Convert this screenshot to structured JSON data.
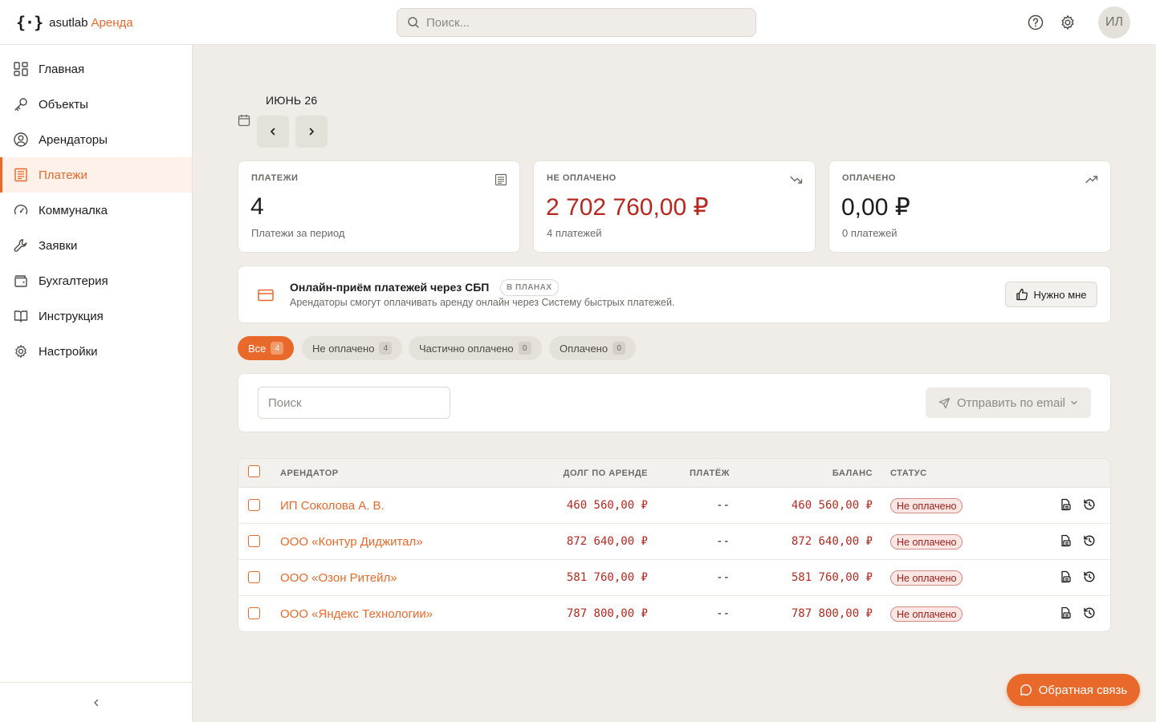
{
  "brand": {
    "mark": "{·}",
    "name": "asutlab",
    "product": "Аренда"
  },
  "header": {
    "search_placeholder": "Поиск...",
    "help_icon": "question-circle-icon",
    "settings_icon": "gear-icon",
    "avatar_initials": "ИЛ"
  },
  "sidebar": {
    "items": [
      {
        "label": "Главная",
        "icon": "dashboard-icon",
        "active": false
      },
      {
        "label": "Объекты",
        "icon": "key-icon",
        "active": false
      },
      {
        "label": "Арендаторы",
        "icon": "user-circle-icon",
        "active": false
      },
      {
        "label": "Платежи",
        "icon": "receipt-icon",
        "active": true
      },
      {
        "label": "Коммуналка",
        "icon": "gauge-icon",
        "active": false
      },
      {
        "label": "Заявки",
        "icon": "wrench-icon",
        "active": false
      },
      {
        "label": "Бухгалтерия",
        "icon": "wallet-icon",
        "active": false
      },
      {
        "label": "Инструкция",
        "icon": "book-icon",
        "active": false
      },
      {
        "label": "Настройки",
        "icon": "gear-icon",
        "active": false
      }
    ],
    "collapse_icon": "chevron-left-icon"
  },
  "period": {
    "label": "ИЮНЬ 26"
  },
  "stats": [
    {
      "label": "ПЛАТЕЖИ",
      "value": "4",
      "sub": "Платежи за период",
      "icon": "receipt-icon"
    },
    {
      "label": "НЕ ОПЛАЧЕНО",
      "value": "2 702 760,00 ₽",
      "sub": "4 платежей",
      "icon": "trending-down-icon"
    },
    {
      "label": "ОПЛАЧЕНО",
      "value": "0,00 ₽",
      "sub": "0 платежей",
      "icon": "trending-up-icon"
    }
  ],
  "banner": {
    "title": "Онлайн-приём платежей через СБП",
    "badge": "В ПЛАНАХ",
    "desc": "Арендаторы смогут оплачивать аренду онлайн через Систему быстрых платежей.",
    "button": "Нужно мне"
  },
  "filters": [
    {
      "label": "Все",
      "count": "4",
      "active": true
    },
    {
      "label": "Не оплачено",
      "count": "4",
      "active": false
    },
    {
      "label": "Частично оплачено",
      "count": "0",
      "active": false
    },
    {
      "label": "Оплачено",
      "count": "0",
      "active": false
    }
  ],
  "toolbar": {
    "search_placeholder": "Поиск",
    "email_button": "Отправить по email"
  },
  "table": {
    "columns": {
      "tenant": "АРЕНДАТОР",
      "debt": "ДОЛГ ПО АРЕНДЕ",
      "payment": "ПЛАТЁЖ",
      "balance": "БАЛАНС",
      "status": "СТАТУС"
    },
    "rows": [
      {
        "tenant": "ИП Соколова А. В.",
        "debt": "460 560,00 ₽",
        "payment": "--",
        "balance": "460 560,00 ₽",
        "status": "Не оплачено"
      },
      {
        "tenant": "ООО «Контур Диджитал»",
        "debt": "872 640,00 ₽",
        "payment": "--",
        "balance": "872 640,00 ₽",
        "status": "Не оплачено"
      },
      {
        "tenant": "ООО «Озон Ритейл»",
        "debt": "581 760,00 ₽",
        "payment": "--",
        "balance": "581 760,00 ₽",
        "status": "Не оплачено"
      },
      {
        "tenant": "ООО «Яндекс Технологии»",
        "debt": "787 800,00 ₽",
        "payment": "--",
        "balance": "787 800,00 ₽",
        "status": "Не оплачено"
      }
    ]
  },
  "feedback": {
    "label": "Обратная связь"
  },
  "colors": {
    "accent": "#e8692a",
    "danger": "#b8281f",
    "background": "#f0ede8"
  }
}
